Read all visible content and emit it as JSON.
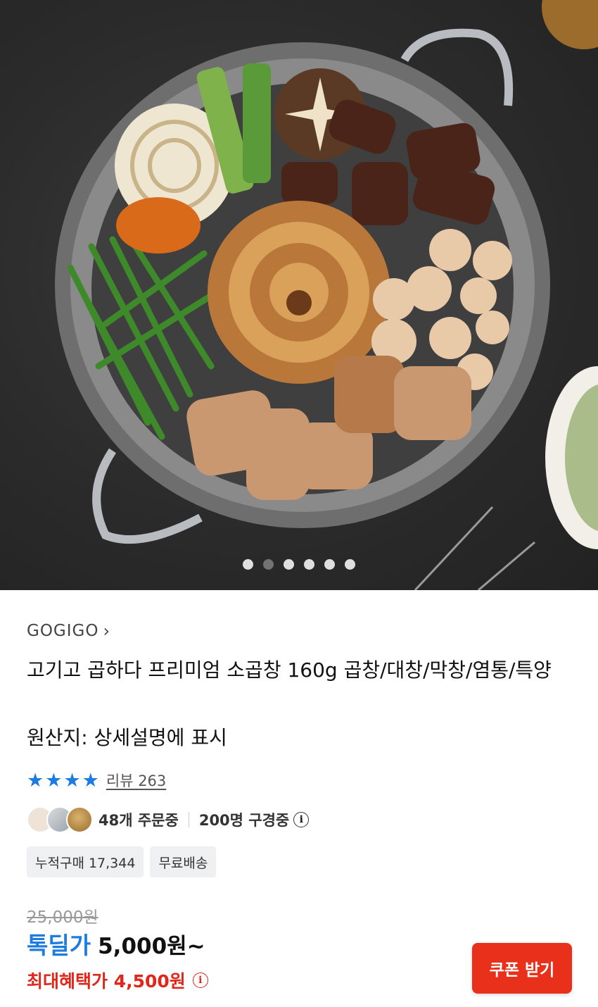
{
  "gallery": {
    "image_icon": "food-photo-gopchang-stone-pan",
    "slides": [
      {
        "active": false
      },
      {
        "active": true
      },
      {
        "active": false
      },
      {
        "active": false
      },
      {
        "active": false
      },
      {
        "active": false
      }
    ]
  },
  "product": {
    "brand": "GOGIGO",
    "brand_chevron": "›",
    "title": "고기고 곱하다 프리미엄 소곱창 160g 곱창/대창/막창/염통/특양",
    "origin": "원산지: 상세설명에 표시"
  },
  "rating": {
    "stars": 4,
    "star_glyph": "★",
    "review_text": "리뷰 263"
  },
  "social": {
    "orders_text": "48개 주문중",
    "viewers_text": "200명 구경중",
    "info_glyph": "i"
  },
  "chips": [
    "누적구매 17,344",
    "무료배송"
  ],
  "price": {
    "original": "25,000원",
    "deal_label": "톡딜가",
    "deal_price": "5,000원~",
    "max_benefit": "최대혜택가 4,500원",
    "info_glyph": "i"
  },
  "coupon_button": "쿠폰 받기",
  "colors": {
    "accent_blue": "#1e7be0",
    "accent_red": "#e0271a",
    "button_red": "#e8301b"
  }
}
